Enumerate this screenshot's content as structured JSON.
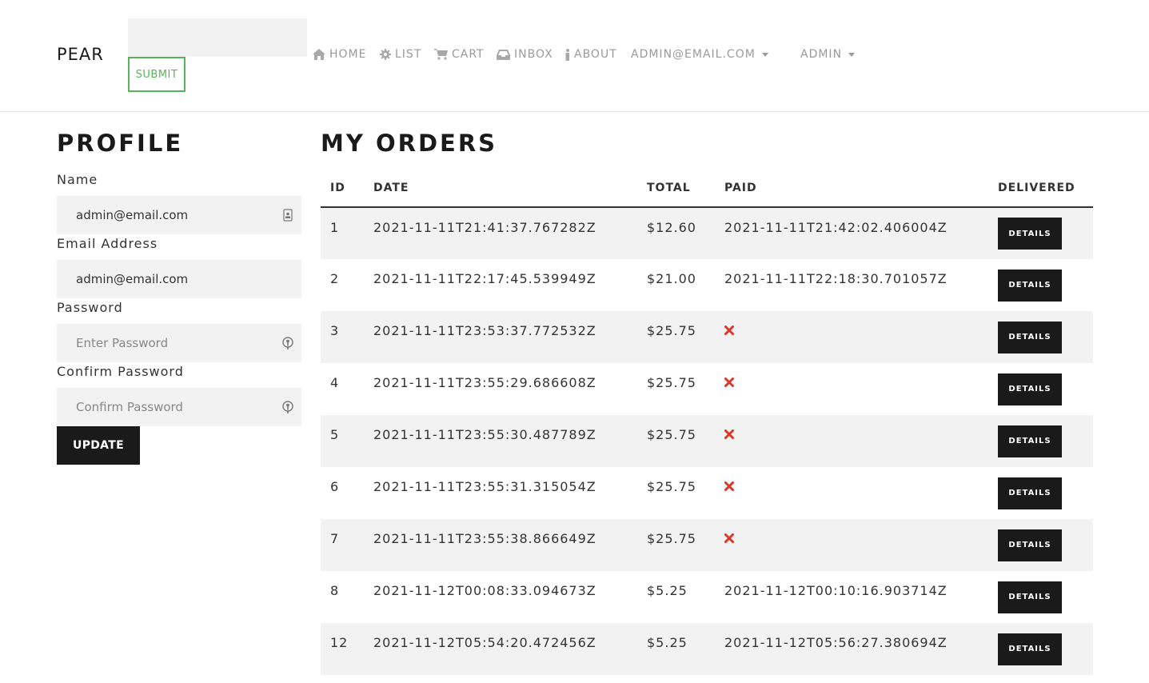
{
  "navbar": {
    "brand": "PEAR",
    "search": {
      "placeholder": "",
      "value": ""
    },
    "submit_label": "SUBMIT",
    "links": [
      {
        "label": "HOME",
        "icon": "home-icon"
      },
      {
        "label": "LIST",
        "icon": "gear-icon"
      },
      {
        "label": "CART",
        "icon": "cart-icon"
      },
      {
        "label": "INBOX",
        "icon": "inbox-icon"
      },
      {
        "label": "ABOUT",
        "icon": "info-icon"
      }
    ],
    "user_menu": "ADMIN@EMAIL.COM",
    "admin_menu": "ADMIN"
  },
  "profile": {
    "title": "PROFILE",
    "name_label": "Name",
    "name_value": "admin@email.com",
    "email_label": "Email Address",
    "email_value": "admin@email.com",
    "password_label": "Password",
    "password_placeholder": "Enter Password",
    "confirm_label": "Confirm Password",
    "confirm_placeholder": "Confirm Password",
    "update_label": "UPDATE"
  },
  "orders": {
    "title": "MY ORDERS",
    "columns": [
      "ID",
      "DATE",
      "TOTAL",
      "PAID",
      "DELIVERED"
    ],
    "details_label": "DETAILS",
    "rows": [
      {
        "id": "1",
        "date": "2021-11-11T21:41:37.767282Z",
        "total": "$12.60",
        "paid": "2021-11-11T21:42:02.406004Z"
      },
      {
        "id": "2",
        "date": "2021-11-11T22:17:45.539949Z",
        "total": "$21.00",
        "paid": "2021-11-11T22:18:30.701057Z"
      },
      {
        "id": "3",
        "date": "2021-11-11T23:53:37.772532Z",
        "total": "$25.75",
        "paid": ""
      },
      {
        "id": "4",
        "date": "2021-11-11T23:55:29.686608Z",
        "total": "$25.75",
        "paid": ""
      },
      {
        "id": "5",
        "date": "2021-11-11T23:55:30.487789Z",
        "total": "$25.75",
        "paid": ""
      },
      {
        "id": "6",
        "date": "2021-11-11T23:55:31.315054Z",
        "total": "$25.75",
        "paid": ""
      },
      {
        "id": "7",
        "date": "2021-11-11T23:55:38.866649Z",
        "total": "$25.75",
        "paid": ""
      },
      {
        "id": "8",
        "date": "2021-11-12T00:08:33.094673Z",
        "total": "$5.25",
        "paid": "2021-11-12T00:10:16.903714Z"
      },
      {
        "id": "12",
        "date": "2021-11-12T05:54:20.472456Z",
        "total": "$5.25",
        "paid": "2021-11-12T05:56:27.380694Z"
      }
    ]
  },
  "colors": {
    "accent_green": "#55b559",
    "unpaid_red": "#d9392a",
    "dark": "#1a1a1a",
    "stripe": "#f2f2f2"
  }
}
